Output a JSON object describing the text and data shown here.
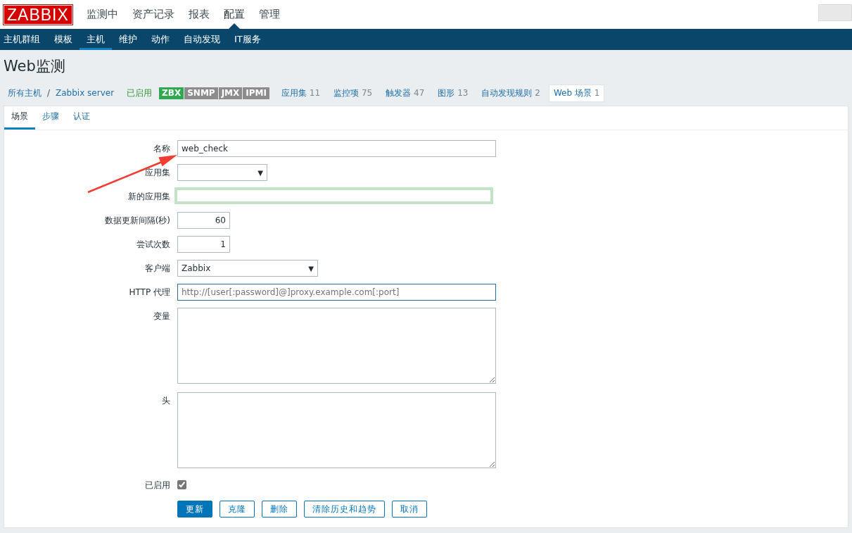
{
  "logo": "ZABBIX",
  "top_menu": [
    {
      "label": "监测中",
      "selected": false
    },
    {
      "label": "资产记录",
      "selected": false
    },
    {
      "label": "报表",
      "selected": false
    },
    {
      "label": "配置",
      "selected": true
    },
    {
      "label": "管理",
      "selected": false
    }
  ],
  "sub_menu": [
    {
      "label": "主机群组",
      "selected": false
    },
    {
      "label": "模板",
      "selected": false
    },
    {
      "label": "主机",
      "selected": true
    },
    {
      "label": "维护",
      "selected": false
    },
    {
      "label": "动作",
      "selected": false
    },
    {
      "label": "自动发现",
      "selected": false
    },
    {
      "label": "IT服务",
      "selected": false
    }
  ],
  "page_title": "Web监测",
  "breadcrumb": {
    "items": [
      "所有主机",
      "Zabbix server"
    ],
    "separator": "/",
    "status": "已启用",
    "badges": [
      {
        "label": "ZBX",
        "color": "#2fa84f"
      },
      {
        "label": "SNMP",
        "color": "#8c8c8c"
      },
      {
        "label": "JMX",
        "color": "#8c8c8c"
      },
      {
        "label": "IPMI",
        "color": "#8c8c8c"
      }
    ],
    "links": [
      {
        "label": "应用集",
        "count": "11",
        "selected": false
      },
      {
        "label": "监控项",
        "count": "75",
        "selected": false
      },
      {
        "label": "触发器",
        "count": "47",
        "selected": false
      },
      {
        "label": "图形",
        "count": "13",
        "selected": false
      },
      {
        "label": "自动发现规则",
        "count": "2",
        "selected": false
      },
      {
        "label": "Web 场景",
        "count": "1",
        "selected": true
      }
    ]
  },
  "form_tabs": [
    {
      "label": "场景",
      "selected": true
    },
    {
      "label": "步骤",
      "selected": false
    },
    {
      "label": "认证",
      "selected": false
    }
  ],
  "fields": [
    {
      "kind": "text",
      "label": "名称",
      "value": "web_check",
      "highlighted": false,
      "focused": false
    },
    {
      "kind": "shortselect",
      "label": "应用集",
      "caret": "▼"
    },
    {
      "kind": "text",
      "label": "新的应用集",
      "highlighted": true,
      "focused": false
    },
    {
      "kind": "number",
      "label": "数据更新间隔(秒)",
      "value": "60"
    },
    {
      "kind": "number",
      "label": "尝试次数",
      "value": "1"
    },
    {
      "kind": "select",
      "label": "客户端",
      "value": "Zabbix",
      "caret": "▼"
    },
    {
      "kind": "text",
      "label": "HTTP 代理",
      "placeholder": "http://[user[:password]@]proxy.example.com[:port]",
      "highlighted": false,
      "focused": true
    },
    {
      "kind": "textarea",
      "label": "变量"
    },
    {
      "kind": "textarea",
      "label": "头"
    },
    {
      "kind": "checkbox",
      "label": "已启用",
      "checked": true
    }
  ],
  "buttons": [
    {
      "label": "更新",
      "primary": true
    },
    {
      "label": "克隆",
      "primary": false
    },
    {
      "label": "删除",
      "primary": false
    },
    {
      "label": "清除历史和趋势",
      "primary": false
    },
    {
      "label": "取消",
      "primary": false
    }
  ]
}
